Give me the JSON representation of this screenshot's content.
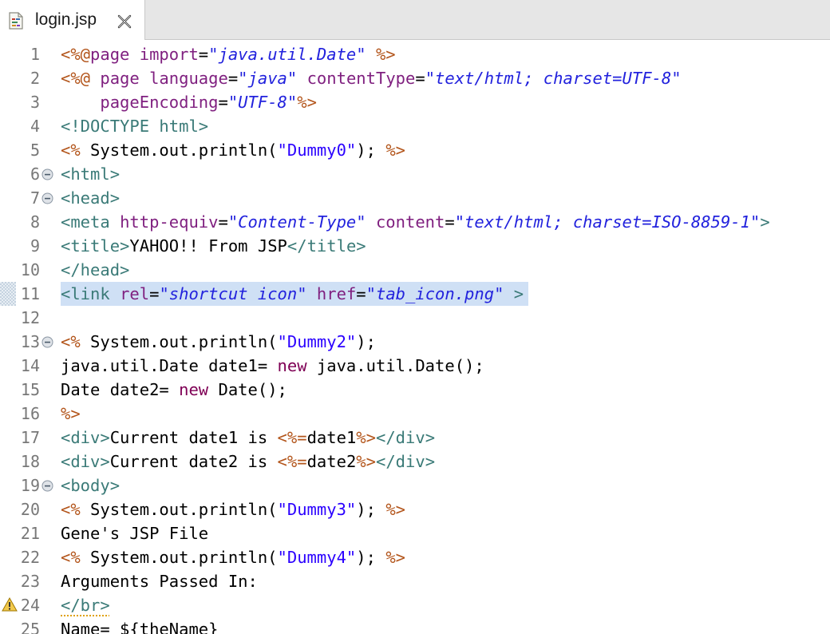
{
  "tab": {
    "title": "login.jsp",
    "file_icon": "jsp-file-icon",
    "close_icon": "close-icon"
  },
  "colors": {
    "jsp_delimiter": "#b3551b",
    "html_tag": "#3a7a77",
    "attribute_name": "#7f1f7f",
    "attribute_value": "#2222dd",
    "string_literal": "#2a00ff",
    "keyword": "#7f0055",
    "selection": "#cfe0f5"
  },
  "lines": [
    {
      "num": "1",
      "tokens": [
        [
          "delim",
          "<%@"
        ],
        [
          "attr",
          "page import"
        ],
        [
          "plain",
          "="
        ],
        [
          "val",
          "\"java.util.Date\""
        ],
        [
          "plain",
          " "
        ],
        [
          "delim",
          "%>"
        ]
      ]
    },
    {
      "num": "2",
      "tokens": [
        [
          "delim",
          "<%@"
        ],
        [
          "plain",
          " "
        ],
        [
          "attr",
          "page language"
        ],
        [
          "plain",
          "="
        ],
        [
          "val",
          "\"java\""
        ],
        [
          "plain",
          " "
        ],
        [
          "attr",
          "contentType"
        ],
        [
          "plain",
          "="
        ],
        [
          "val",
          "\"text/html; charset=UTF-8\""
        ]
      ]
    },
    {
      "num": "3",
      "tokens": [
        [
          "plain",
          "    "
        ],
        [
          "attr",
          "pageEncoding"
        ],
        [
          "plain",
          "="
        ],
        [
          "val",
          "\"UTF-8\""
        ],
        [
          "delim",
          "%>"
        ]
      ]
    },
    {
      "num": "4",
      "tokens": [
        [
          "tag",
          "<!DOCTYPE html>"
        ]
      ]
    },
    {
      "num": "5",
      "tokens": [
        [
          "delim",
          "<%"
        ],
        [
          "plain",
          " System.out.println("
        ],
        [
          "str",
          "\"Dummy0\""
        ],
        [
          "plain",
          "); "
        ],
        [
          "delim",
          "%>"
        ]
      ]
    },
    {
      "num": "6",
      "fold": true,
      "tokens": [
        [
          "tag",
          "<html>"
        ]
      ]
    },
    {
      "num": "7",
      "fold": true,
      "tokens": [
        [
          "tag",
          "<head>"
        ]
      ]
    },
    {
      "num": "8",
      "tokens": [
        [
          "tag",
          "<meta"
        ],
        [
          "plain",
          " "
        ],
        [
          "attr",
          "http-equiv"
        ],
        [
          "plain",
          "="
        ],
        [
          "val",
          "\"Content-Type\""
        ],
        [
          "plain",
          " "
        ],
        [
          "attr",
          "content"
        ],
        [
          "plain",
          "="
        ],
        [
          "val",
          "\"text/html; charset=ISO-8859-1\""
        ],
        [
          "tag",
          ">"
        ]
      ]
    },
    {
      "num": "9",
      "tokens": [
        [
          "tag",
          "<title>"
        ],
        [
          "plain",
          "YAHOO!! From JSP"
        ],
        [
          "tag",
          "</title>"
        ]
      ]
    },
    {
      "num": "10",
      "tokens": [
        [
          "tag",
          "</head>"
        ]
      ]
    },
    {
      "num": "11",
      "selected": true,
      "tokens": [
        [
          "tag",
          "<link"
        ],
        [
          "plain",
          " "
        ],
        [
          "attr",
          "rel"
        ],
        [
          "plain",
          "="
        ],
        [
          "val",
          "\"shortcut icon\""
        ],
        [
          "plain",
          " "
        ],
        [
          "attr",
          "href"
        ],
        [
          "plain",
          "="
        ],
        [
          "val",
          "\"tab_icon.png\""
        ],
        [
          "plain",
          " "
        ],
        [
          "tag",
          ">"
        ]
      ]
    },
    {
      "num": "12",
      "tokens": []
    },
    {
      "num": "13",
      "fold": true,
      "tokens": [
        [
          "delim",
          "<%"
        ],
        [
          "plain",
          " System.out.println("
        ],
        [
          "str",
          "\"Dummy2\""
        ],
        [
          "plain",
          ");"
        ]
      ]
    },
    {
      "num": "14",
      "tokens": [
        [
          "plain",
          "java.util.Date date1= "
        ],
        [
          "kw",
          "new"
        ],
        [
          "plain",
          " java.util.Date();"
        ]
      ]
    },
    {
      "num": "15",
      "tokens": [
        [
          "plain",
          "Date date2= "
        ],
        [
          "kw",
          "new"
        ],
        [
          "plain",
          " Date();"
        ]
      ]
    },
    {
      "num": "16",
      "tokens": [
        [
          "delim",
          "%>"
        ]
      ]
    },
    {
      "num": "17",
      "tokens": [
        [
          "tag",
          "<div>"
        ],
        [
          "plain",
          "Current date1 is "
        ],
        [
          "delim",
          "<%="
        ],
        [
          "plain",
          "date1"
        ],
        [
          "delim",
          "%>"
        ],
        [
          "tag",
          "</div>"
        ]
      ]
    },
    {
      "num": "18",
      "tokens": [
        [
          "tag",
          "<div>"
        ],
        [
          "plain",
          "Current date2 is "
        ],
        [
          "delim",
          "<%="
        ],
        [
          "plain",
          "date2"
        ],
        [
          "delim",
          "%>"
        ],
        [
          "tag",
          "</div>"
        ]
      ]
    },
    {
      "num": "19",
      "fold": true,
      "tokens": [
        [
          "tag",
          "<body>"
        ]
      ]
    },
    {
      "num": "20",
      "tokens": [
        [
          "delim",
          "<%"
        ],
        [
          "plain",
          " System.out.println("
        ],
        [
          "str",
          "\"Dummy3\""
        ],
        [
          "plain",
          "); "
        ],
        [
          "delim",
          "%>"
        ]
      ]
    },
    {
      "num": "21",
      "tokens": [
        [
          "plain",
          "Gene's JSP File"
        ]
      ]
    },
    {
      "num": "22",
      "tokens": [
        [
          "delim",
          "<%"
        ],
        [
          "plain",
          " System.out.println("
        ],
        [
          "str",
          "\"Dummy4\""
        ],
        [
          "plain",
          "); "
        ],
        [
          "delim",
          "%>"
        ]
      ]
    },
    {
      "num": "23",
      "tokens": [
        [
          "plain",
          "Arguments Passed In:"
        ]
      ]
    },
    {
      "num": "24",
      "warning": true,
      "tokens": [
        [
          "tag-ul",
          "</br>"
        ]
      ]
    },
    {
      "num": "25",
      "tokens": [
        [
          "plain",
          "Name= ${theName}"
        ]
      ]
    }
  ]
}
